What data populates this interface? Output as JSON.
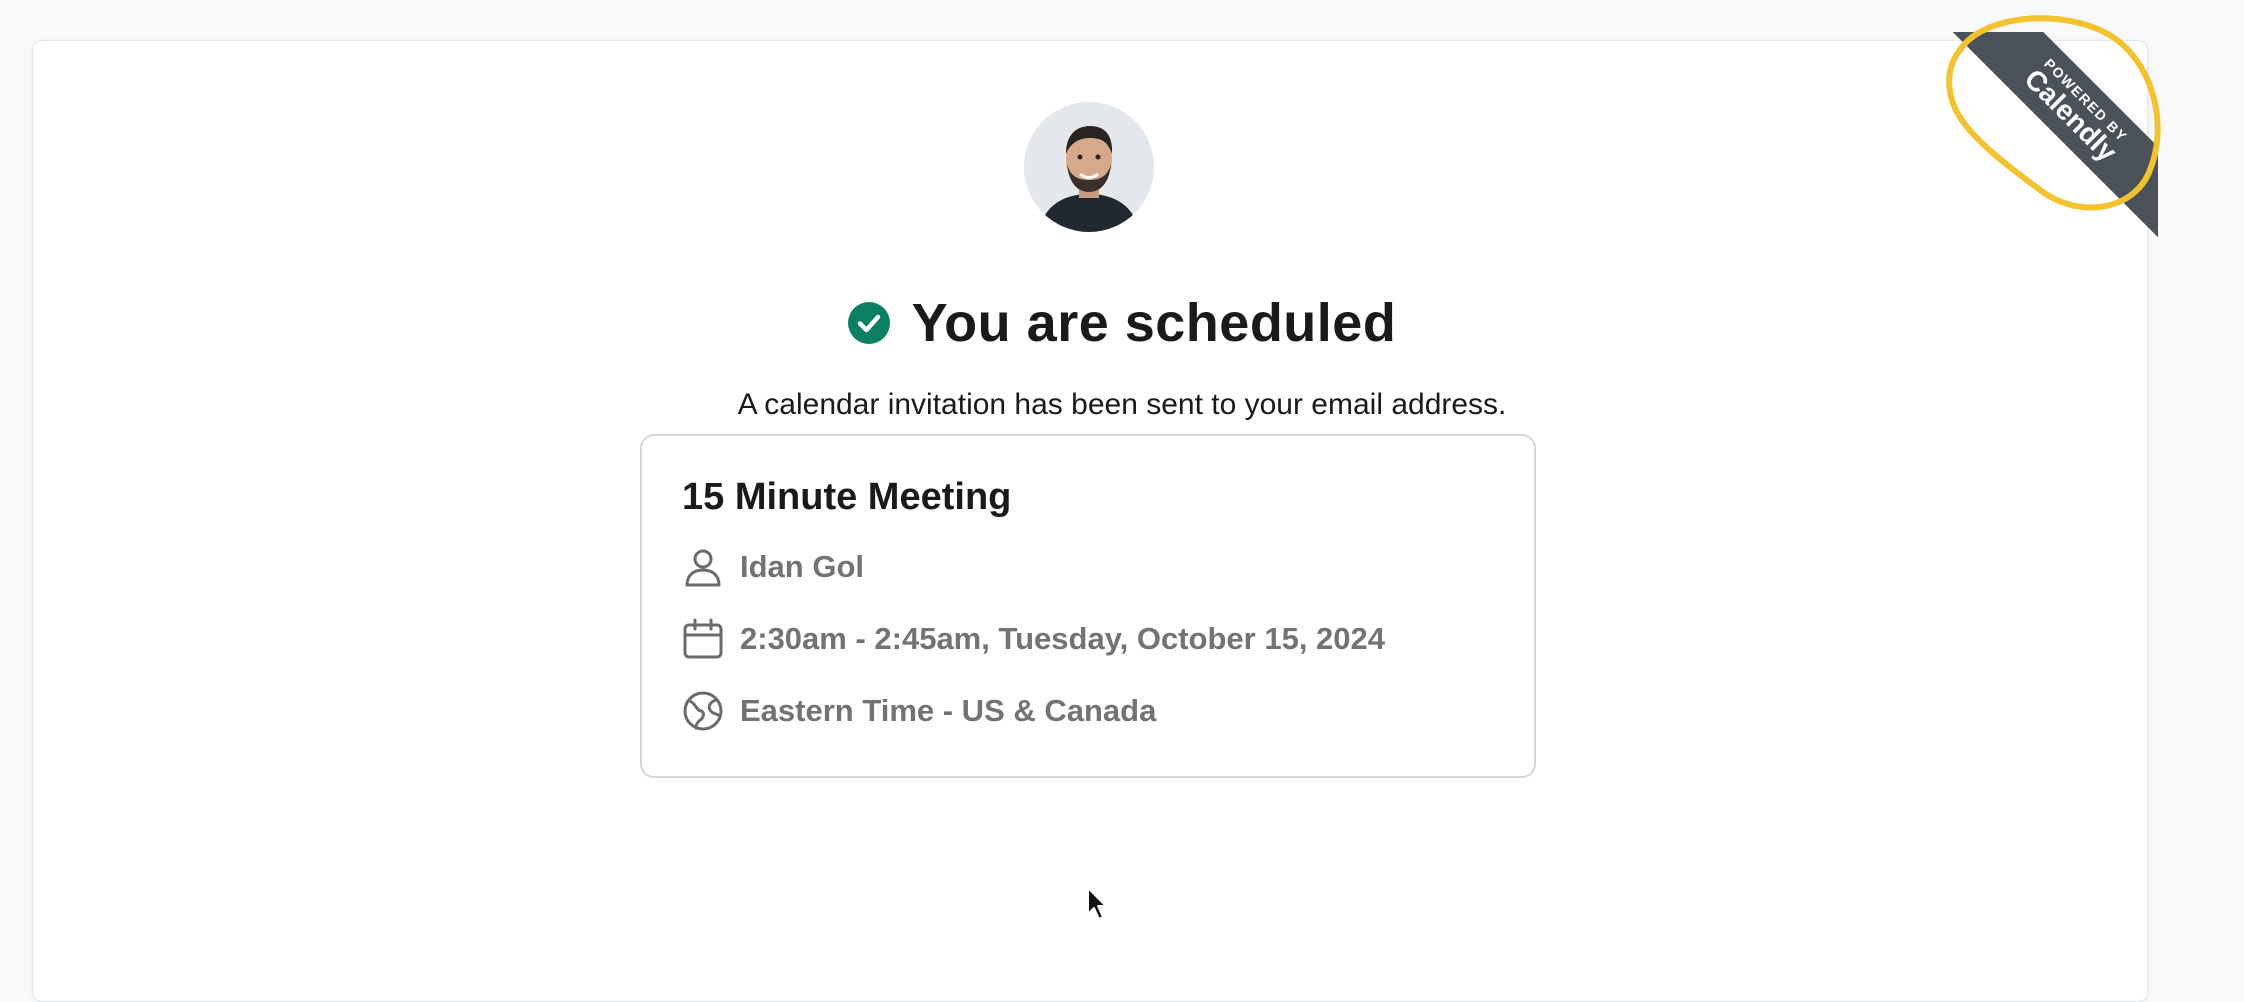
{
  "header": {
    "title": "You are scheduled",
    "subtitle": "A calendar invitation has been sent to your email address."
  },
  "event": {
    "name": "15 Minute Meeting",
    "host": "Idan Gol",
    "time": "2:30am - 2:45am, Tuesday, October 15, 2024",
    "timezone": "Eastern Time - US & Canada"
  },
  "badge": {
    "small_text": "POWERED BY",
    "brand": "Calendly"
  },
  "icons": {
    "status": "check-circle-icon",
    "host": "person-icon",
    "time": "calendar-icon",
    "timezone": "globe-icon"
  },
  "colors": {
    "success": "#0a7f62",
    "ribbon": "#4a5158",
    "annotation": "#f2c230",
    "muted_text": "#737373"
  }
}
